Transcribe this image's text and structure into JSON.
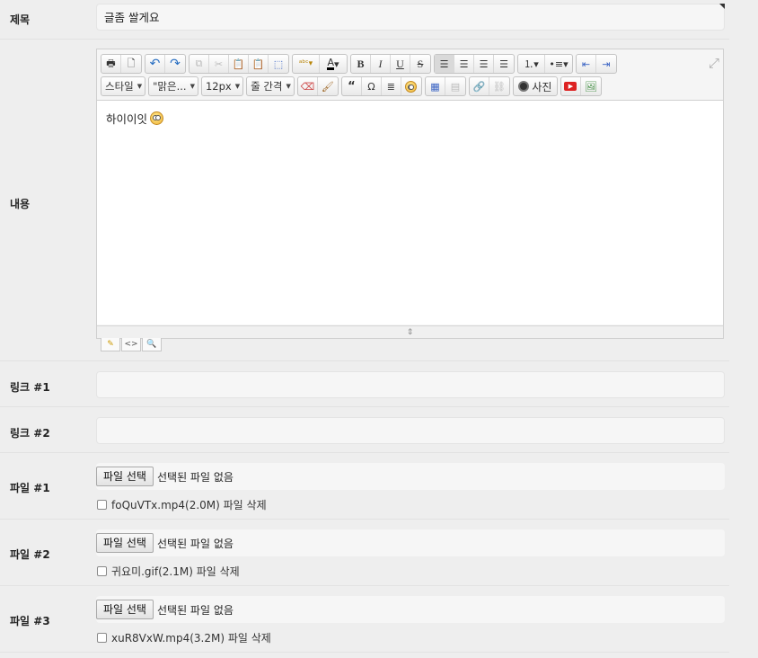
{
  "title_row": {
    "label": "제목",
    "value": "글좀 쌀게요"
  },
  "content_row": {
    "label": "내용",
    "body_text": "하이이잇",
    "dropdowns": {
      "style": "스타일",
      "font": "\"맑은...",
      "size": "12px",
      "line_height": "줄 간격"
    },
    "toolbar": {
      "bold": "B",
      "italic": "I",
      "underline": "U",
      "strike": "S",
      "quote": "“",
      "omega": "Ω",
      "photo": "사진"
    }
  },
  "link_rows": [
    {
      "label": "링크 #1",
      "value": ""
    },
    {
      "label": "링크 #2",
      "value": ""
    }
  ],
  "file_rows": [
    {
      "label": "파일 #1",
      "button": "파일 선택",
      "status": "선택된 파일 없음",
      "existing": "foQuVTx.mp4(2.0M) 파일 삭제"
    },
    {
      "label": "파일 #2",
      "button": "파일 선택",
      "status": "선택된 파일 없음",
      "existing": "귀요미.gif(2.1M) 파일 삭제"
    },
    {
      "label": "파일 #3",
      "button": "파일 선택",
      "status": "선택된 파일 없음",
      "existing": "xuR8VxW.mp4(3.2M) 파일 삭제"
    }
  ]
}
